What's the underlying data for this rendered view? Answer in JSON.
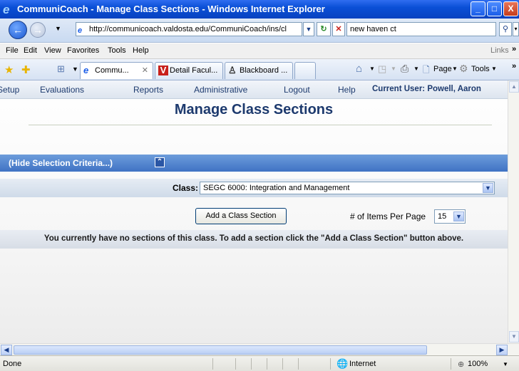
{
  "window": {
    "title": "CommuniCoach - Manage Class Sections - Windows Internet Explorer",
    "minimize_glyph": "_",
    "maximize_glyph": "□",
    "close_glyph": "X"
  },
  "address_bar": {
    "url": "http://communicoach.valdosta.edu/CommuniCoach/ins/cl",
    "search_text": "new haven ct"
  },
  "menu": {
    "items": [
      "File",
      "Edit",
      "View",
      "Favorites",
      "Tools",
      "Help"
    ],
    "links_label": "Links",
    "overflow": "»"
  },
  "tabs": [
    {
      "label": "Commu...",
      "icon": "ie-icon"
    },
    {
      "label": "Detail Facul...",
      "icon": "v-logo-icon"
    },
    {
      "label": "Blackboard ...",
      "icon": "blackboard-icon"
    }
  ],
  "toolbar": {
    "page_label": "Page",
    "tools_label": "Tools"
  },
  "app_nav": {
    "items": [
      "Setup",
      "Evaluations",
      "Reports",
      "Administrative",
      "Logout",
      "Help"
    ],
    "current_user": "Current User: Powell, Aaron"
  },
  "page": {
    "heading": "Manage Class Sections",
    "criteria_toggle": "(Hide Selection Criteria...)",
    "class_label": "Class:",
    "class_value": "SEGC 6000: Integration and Management",
    "add_button": "Add a Class Section",
    "items_per_page_label": "# of Items Per Page",
    "items_per_page_value": "15",
    "message": "You currently have no sections of this class. To add a section click the \"Add a Class Section\" button above."
  },
  "status_bar": {
    "status": "Done",
    "zone": "Internet",
    "zoom": "100%"
  }
}
